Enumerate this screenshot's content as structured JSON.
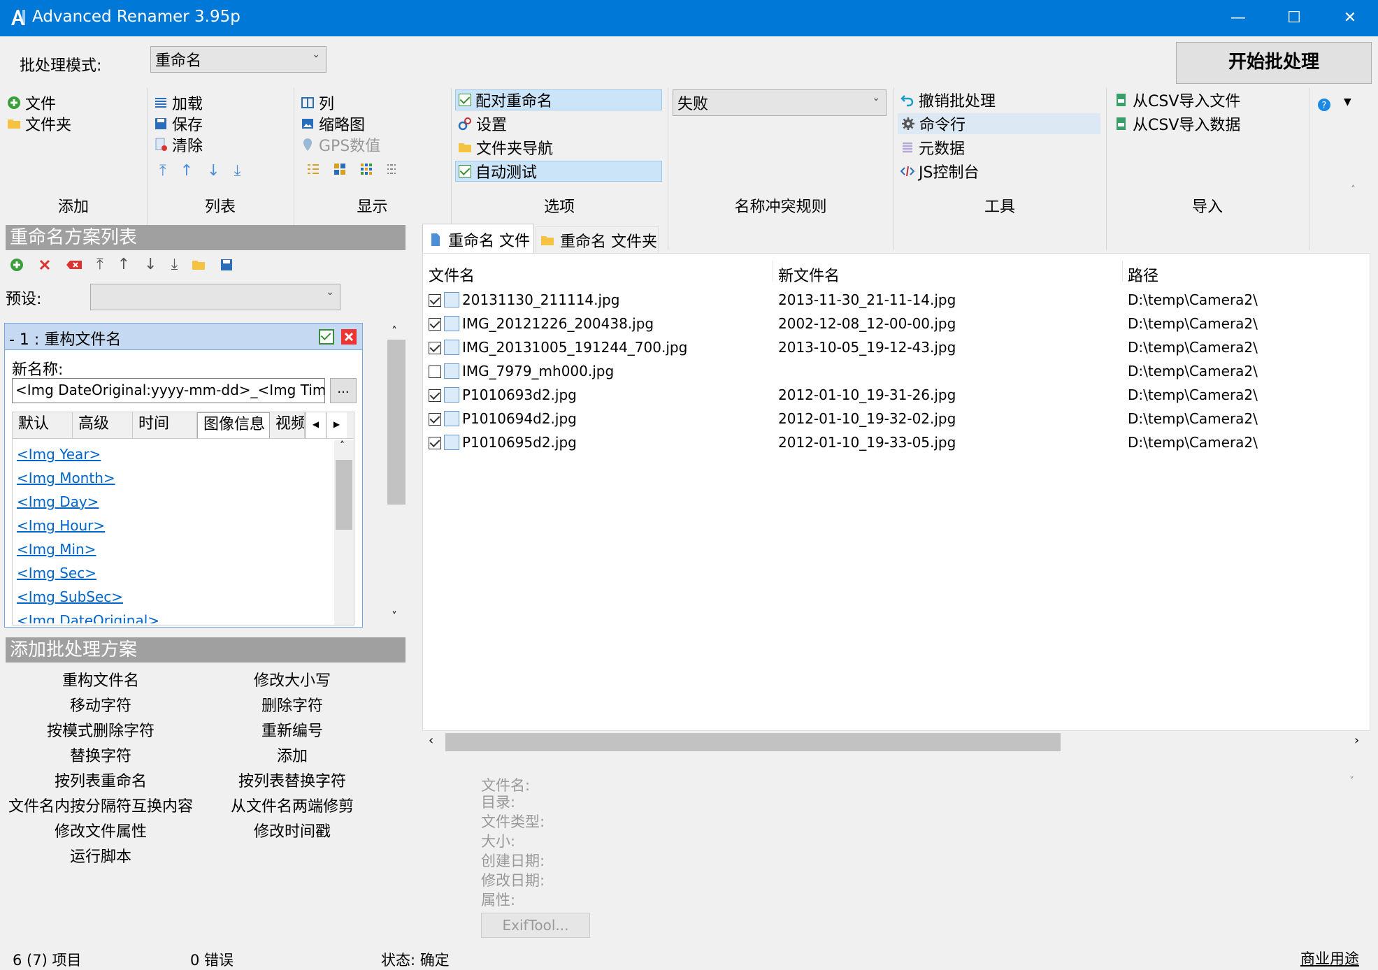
{
  "window": {
    "title": "Advanced Renamer 3.95p",
    "min": "—",
    "max": "☐",
    "close": "✕"
  },
  "batch": {
    "label": "批处理模式:",
    "mode": "重命名",
    "start": "开始批处理"
  },
  "ribbon": {
    "add": {
      "items": [
        "文件",
        "文件夹"
      ],
      "label": "添加"
    },
    "list": {
      "items": [
        "加载",
        "保存",
        "清除"
      ],
      "label": "列表"
    },
    "display": {
      "items": [
        "列",
        "缩略图",
        "GPS数值"
      ],
      "label": "显示"
    },
    "options": {
      "items": [
        "配对重命名",
        "设置",
        "文件夹导航",
        "自动测试"
      ],
      "label": "选项"
    },
    "conflict": {
      "value": "失败",
      "label": "名称冲突规则"
    },
    "tools": {
      "items": [
        "撤销批处理",
        "命令行",
        "元数据",
        "JS控制台"
      ],
      "label": "工具"
    },
    "import": {
      "items": [
        "从CSV导入文件",
        "从CSV导入数据"
      ],
      "label": "导入"
    }
  },
  "methods_panel": {
    "title": "重命名方案列表",
    "preset_label": "预设:",
    "preset_value": "",
    "method": {
      "title": "- 1 : 重构文件名",
      "new_name_label": "新名称:",
      "new_name_value": "<Img DateOriginal:yyyy-mm-dd>_<Img TimeO",
      "browse": "...",
      "tabs": [
        "默认",
        "高级",
        "时间",
        "图像信息",
        "视频"
      ],
      "tags": [
        "<Img Year>",
        "<Img Month>",
        "<Img Day>",
        "<Img Hour>",
        "<Img Min>",
        "<Img Sec>",
        "<Img SubSec>",
        "<Img DateOriginal>"
      ]
    }
  },
  "add_method_panel": {
    "title": "添加批处理方案",
    "left": [
      "重构文件名",
      "移动字符",
      "按模式删除字符",
      "替换字符",
      "按列表重命名",
      "文件名内按分隔符互换内容",
      "修改文件属性",
      "运行脚本"
    ],
    "right": [
      "修改大小写",
      "删除字符",
      "重新编号",
      "添加",
      "按列表替换字符",
      "从文件名两端修剪",
      "修改时间戳"
    ]
  },
  "file_tabs": [
    "重命名 文件",
    "重命名 文件夹"
  ],
  "columns": [
    "文件名",
    "新文件名",
    "路径"
  ],
  "files": [
    {
      "checked": true,
      "name": "20131130_211114.jpg",
      "new_name": "2013-11-30_21-11-14.jpg",
      "path": "D:\\temp\\Camera2\\"
    },
    {
      "checked": true,
      "name": "IMG_20121226_200438.jpg",
      "new_name": "2002-12-08_12-00-00.jpg",
      "path": "D:\\temp\\Camera2\\"
    },
    {
      "checked": true,
      "name": "IMG_20131005_191244_700.jpg",
      "new_name": "2013-10-05_19-12-43.jpg",
      "path": "D:\\temp\\Camera2\\"
    },
    {
      "checked": false,
      "name": "IMG_7979_mh000.jpg",
      "new_name": "",
      "path": "D:\\temp\\Camera2\\"
    },
    {
      "checked": true,
      "name": "P1010693d2.jpg",
      "new_name": "2012-01-10_19-31-26.jpg",
      "path": "D:\\temp\\Camera2\\"
    },
    {
      "checked": true,
      "name": "P1010694d2.jpg",
      "new_name": "2012-01-10_19-32-02.jpg",
      "path": "D:\\temp\\Camera2\\"
    },
    {
      "checked": true,
      "name": "P1010695d2.jpg",
      "new_name": "2012-01-10_19-33-05.jpg",
      "path": "D:\\temp\\Camera2\\"
    }
  ],
  "info": {
    "labels": [
      "文件名:",
      "目录:",
      "文件类型:",
      "大小:",
      "创建日期:",
      "修改日期:",
      "属性:"
    ],
    "exiftool": "ExifTool..."
  },
  "status": {
    "items": "6 (7) 项目",
    "errors": "0 错误",
    "state": "状态: 确定",
    "license": "商业用途"
  },
  "colors": {
    "titlebar": "#0078d7",
    "panel_header": "#a0a0a0",
    "highlight": "#cce4f7",
    "link": "#0066cc"
  }
}
